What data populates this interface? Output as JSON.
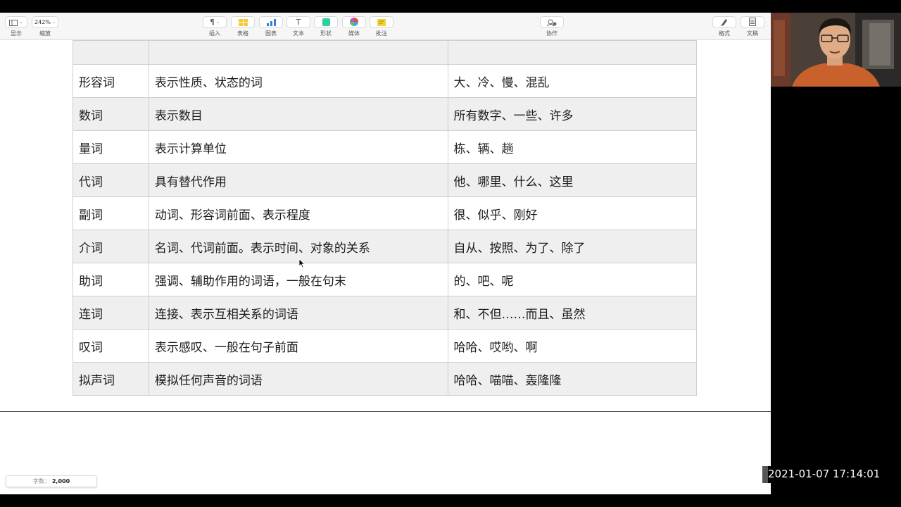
{
  "toolbar": {
    "left": [
      {
        "id": "view",
        "label": "显示",
        "icon": "sidebar-icon"
      },
      {
        "id": "zoom",
        "label": "缩放",
        "value": "242%"
      }
    ],
    "center": [
      {
        "id": "insert",
        "label": "插入",
        "icon": "pilcrow-icon",
        "glyph": "¶"
      },
      {
        "id": "table",
        "label": "表格",
        "icon": "table-icon"
      },
      {
        "id": "chart",
        "label": "图表",
        "icon": "chart-icon"
      },
      {
        "id": "text",
        "label": "文本",
        "icon": "text-icon",
        "glyph": "T"
      },
      {
        "id": "shape",
        "label": "形状",
        "icon": "shape-icon"
      },
      {
        "id": "media",
        "label": "媒体",
        "icon": "media-icon"
      },
      {
        "id": "comment",
        "label": "批注",
        "icon": "comment-icon"
      }
    ],
    "collab": {
      "label": "协作",
      "icon": "collaborate-icon"
    },
    "right": [
      {
        "id": "format",
        "label": "格式",
        "icon": "format-brush-icon"
      },
      {
        "id": "document",
        "label": "文稿",
        "icon": "document-icon"
      }
    ]
  },
  "table": {
    "rows": [
      [
        "",
        "",
        ""
      ],
      [
        "形容词",
        "表示性质、状态的词",
        "大、冷、慢、混乱"
      ],
      [
        "数词",
        "表示数目",
        "所有数字、一些、许多"
      ],
      [
        "量词",
        "表示计算单位",
        "栋、辆、趟"
      ],
      [
        "代词",
        "具有替代作用",
        "他、哪里、什么、这里"
      ],
      [
        "副词",
        "动词、形容词前面、表示程度",
        "很、似乎、刚好"
      ],
      [
        "介词",
        "名词、代词前面。表示时间、对象的关系",
        "自从、按照、为了、除了"
      ],
      [
        "助词",
        "强调、辅助作用的词语，一般在句末",
        "的、吧、呢"
      ],
      [
        "连词",
        "连接、表示互相关系的词语",
        "和、不但……而且、虽然"
      ],
      [
        "叹词",
        "表示感叹、一般在句子前面",
        "哈哈、哎哟、啊"
      ],
      [
        "拟声词",
        "模拟任何声音的词语",
        "哈哈、喵喵、轰隆隆"
      ]
    ]
  },
  "status": {
    "word_count_label": "字数：",
    "word_count_value": "2,000"
  },
  "recording": {
    "timestamp": "2021-01-07  17:14:01"
  },
  "colors": {
    "accent_table": "#f3c934",
    "accent_chart": "#2f7fd6",
    "accent_shape": "#2fcf9f",
    "accent_comment": "#f5d23a"
  }
}
